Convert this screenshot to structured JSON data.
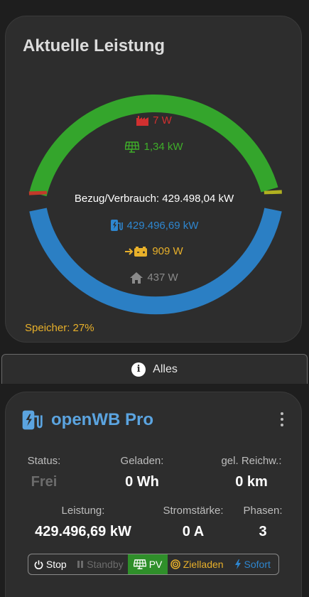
{
  "power": {
    "title": "Aktuelle Leistung",
    "grid_label": "7 W",
    "pv_label": "1,34 kW",
    "total_label": "Bezug/Verbrauch: 429.498,04 kW",
    "charge_label": "429.496,69 kW",
    "battery_label": "909 W",
    "house_label": "437 W",
    "storage_label": "Speicher: 27%",
    "colors": {
      "grid": "#d03030",
      "pv": "#3fae2a",
      "charge": "#2e86cf",
      "battery": "#e8b02a",
      "house": "#8a8a8a"
    },
    "icons": {
      "grid": "factory-icon",
      "pv": "solar-panel-icon",
      "charge": "charging-station-icon",
      "battery": "battery-charging-icon",
      "house": "house-icon"
    }
  },
  "tab": {
    "label": "Alles",
    "icon": "info-icon"
  },
  "chargepoint": {
    "name": "openWB Pro",
    "status_label": "Status:",
    "status_value": "Frei",
    "charged_label": "Geladen:",
    "charged_value": "0 Wh",
    "range_label": "gel. Reichw.:",
    "range_value": "0 km",
    "power_label": "Leistung:",
    "power_value": "429.496,69 kW",
    "current_label": "Stromstärke:",
    "current_value": "0 A",
    "phases_label": "Phasen:",
    "phases_value": "3",
    "modes": {
      "stop": "Stop",
      "standby": "Standby",
      "pv": "PV",
      "target": "Zielladen",
      "instant": "Sofort"
    },
    "selected_mode": "PV"
  }
}
